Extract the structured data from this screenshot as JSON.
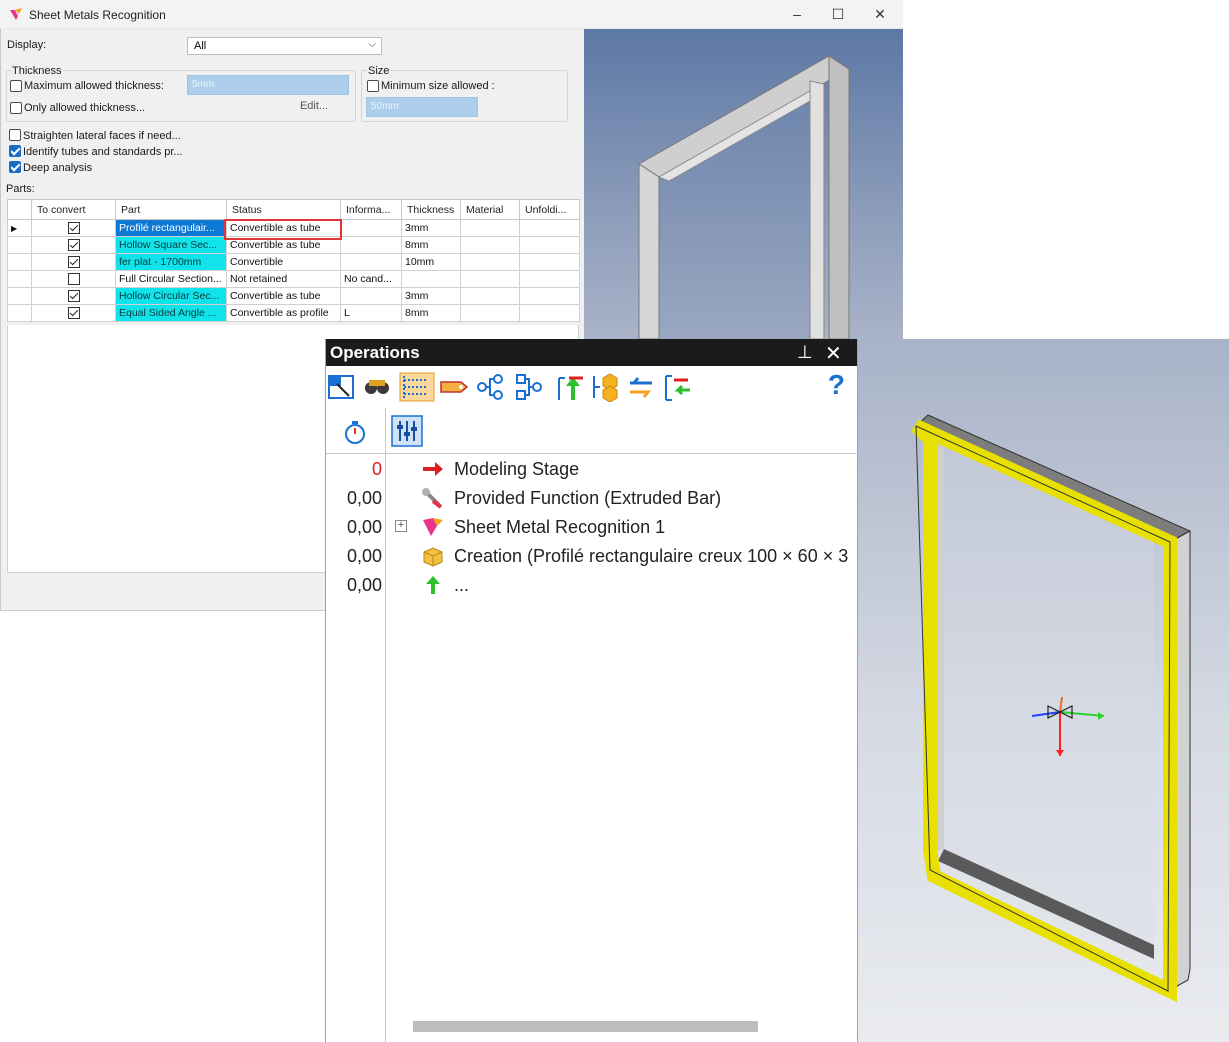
{
  "window": {
    "title": "Sheet Metals Recognition",
    "minimize": "‒",
    "maximize": "☐",
    "close": "✕"
  },
  "dialog": {
    "display_label": "Display:",
    "display_value": "All",
    "thickness_group": "Thickness",
    "max_thickness_label": "Maximum allowed thickness:",
    "max_thickness_value": "5mm",
    "only_allowed_label": "Only allowed thickness...",
    "edit_button": "Edit...",
    "size_group": "Size",
    "min_size_label": "Minimum size allowed :",
    "min_size_value": "50mm",
    "straighten_label": "Straighten lateral faces if need...",
    "identify_label": "Identify tubes and standards pr...",
    "deep_label": "Deep analysis",
    "parts_label": "Parts:",
    "checks": {
      "max_thickness": false,
      "only_allowed": false,
      "min_size": false,
      "straighten": false,
      "identify": true,
      "deep": true
    }
  },
  "table": {
    "headers": [
      "",
      "To convert",
      "Part",
      "Status",
      "Informa...",
      "Thickness",
      "Material",
      "Unfoldi..."
    ],
    "rows": [
      {
        "marker": "▶",
        "convert": true,
        "part": "Profilé rectangulair...",
        "part_style": "sel",
        "status": "Convertible as tube",
        "info": "",
        "thickness": "3mm",
        "material": "",
        "unfold": ""
      },
      {
        "marker": "",
        "convert": true,
        "part": "Hollow Square Sec...",
        "part_style": "cyan",
        "status": "Convertible as tube",
        "info": "",
        "thickness": "8mm",
        "material": "",
        "unfold": ""
      },
      {
        "marker": "",
        "convert": true,
        "part": "fer plat - 1700mm",
        "part_style": "cyan",
        "status": "Convertible",
        "info": "",
        "thickness": "10mm",
        "material": "",
        "unfold": ""
      },
      {
        "marker": "",
        "convert": false,
        "part": "Full Circular Section...",
        "part_style": "",
        "status": "Not retained",
        "info": "No cand...",
        "thickness": "",
        "material": "",
        "unfold": ""
      },
      {
        "marker": "",
        "convert": true,
        "part": "Hollow Circular Sec...",
        "part_style": "cyan",
        "status": "Convertible as tube",
        "info": "",
        "thickness": "3mm",
        "material": "",
        "unfold": ""
      },
      {
        "marker": "",
        "convert": true,
        "part": "Equal Sided Angle ...",
        "part_style": "cyan",
        "status": "Convertible as profile",
        "info": "L",
        "thickness": "8mm",
        "material": "",
        "unfold": ""
      }
    ]
  },
  "operations": {
    "title": "Operations",
    "pin": "📌",
    "close": "✕",
    "help": "?",
    "toolbar_icons": [
      "select-icon",
      "binoculars-icon",
      "numbered-list-icon",
      "tag-icon",
      "tree-left-icon",
      "tree-right-icon",
      "move-up-icon",
      "hexagon-group-icon",
      "swap-arrows-icon",
      "tree-insert-icon"
    ],
    "subbar_icons": [
      "stopwatch-icon",
      "sliders-icon"
    ],
    "tree": [
      {
        "num": "0",
        "num_color": "#e02020",
        "icon": "red-arrow-icon",
        "label": "Modeling Stage",
        "expand": false
      },
      {
        "num": "0,00",
        "num_color": "#222222",
        "icon": "function-wrench-icon",
        "label": "Provided Function (Extruded Bar)",
        "expand": false
      },
      {
        "num": "0,00",
        "num_color": "#222222",
        "icon": "sheet-metal-icon",
        "label": "Sheet Metal Recognition 1",
        "expand": true
      },
      {
        "num": "0,00",
        "num_color": "#222222",
        "icon": "box-creation-icon",
        "label": "Creation (Profilé rectangulaire creux 100 × 60 × 3",
        "expand": false
      },
      {
        "num": "0,00",
        "num_color": "#222222",
        "icon": "green-up-arrow-icon",
        "label": "...",
        "expand": false
      }
    ]
  },
  "colors": {
    "selection_blue": "#0e78d5",
    "cyan_highlight": "#11e3ea",
    "status_highlight_border": "#e0363a",
    "frame_yellow": "#e8e000"
  }
}
